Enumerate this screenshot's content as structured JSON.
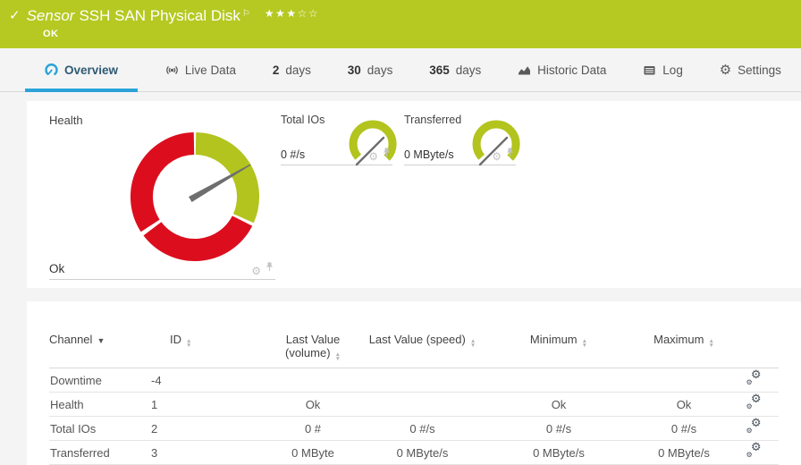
{
  "colors": {
    "ok_green": "#b5c922",
    "gauge_green": "#b2c41d",
    "alarm_red": "#dc0e1e",
    "accent_blue": "#2ba3d8",
    "needle_gray": "#6e6e6e"
  },
  "header": {
    "check_icon": "✓",
    "title_prefix": "Sensor",
    "title": "SSH SAN Physical Disk",
    "flag_icon": "⚐",
    "stars_filled": "★★★",
    "stars_empty": "☆☆",
    "status": "OK"
  },
  "tabs": [
    {
      "label": "Overview",
      "icon": "gauge-icon",
      "active": true
    },
    {
      "label": "Live Data",
      "icon": "broadcast-icon"
    },
    {
      "num": "2",
      "label": "days"
    },
    {
      "num": "30",
      "label": "days"
    },
    {
      "num": "365",
      "label": "days"
    },
    {
      "label": "Historic Data",
      "icon": "area-chart-icon"
    },
    {
      "label": "Log",
      "icon": "log-icon"
    },
    {
      "label": "Settings",
      "icon": "gear-icon"
    }
  ],
  "gauges": {
    "health": {
      "label": "Health",
      "value": "Ok",
      "needle_deg": 60,
      "segments": [
        {
          "color": "green",
          "from_deg": 0,
          "to_deg": 115
        },
        {
          "color": "red",
          "from_deg": 115,
          "to_deg": 235
        },
        {
          "color": "red",
          "from_deg": 235,
          "to_deg": 360
        }
      ]
    },
    "total_ios": {
      "label": "Total IOs",
      "value": "0 #/s"
    },
    "transferred": {
      "label": "Transferred",
      "value": "0 MByte/s"
    }
  },
  "table": {
    "headers": {
      "channel": "Channel",
      "id": "ID",
      "volume_line1": "Last Value",
      "volume_line2": "(volume)",
      "speed": "Last Value (speed)",
      "minimum": "Minimum",
      "maximum": "Maximum"
    },
    "rows": [
      {
        "channel": "Downtime",
        "id": "-4",
        "volume": "",
        "speed": "",
        "minimum": "",
        "maximum": ""
      },
      {
        "channel": "Health",
        "id": "1",
        "volume": "Ok",
        "speed": "",
        "minimum": "Ok",
        "maximum": "Ok"
      },
      {
        "channel": "Total IOs",
        "id": "2",
        "volume": "0 #",
        "speed": "0 #/s",
        "minimum": "0 #/s",
        "maximum": "0 #/s"
      },
      {
        "channel": "Transferred",
        "id": "3",
        "volume": "0 MByte",
        "speed": "0 MByte/s",
        "minimum": "0 MByte/s",
        "maximum": "0 MByte/s"
      }
    ]
  }
}
